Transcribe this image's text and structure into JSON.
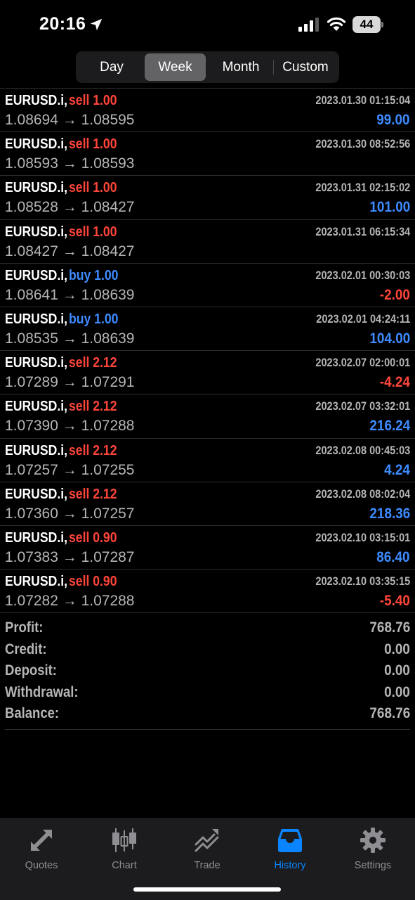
{
  "status_bar": {
    "time": "20:16",
    "battery": "44"
  },
  "periods": {
    "tabs": [
      {
        "label": "Day"
      },
      {
        "label": "Week"
      },
      {
        "label": "Month"
      },
      {
        "label": "Custom"
      }
    ],
    "selected": "Week"
  },
  "deals": [
    {
      "symbol": "EURUSD.i,",
      "side": "sell 1.00",
      "prices": "1.08694 → 1.08595",
      "time": "2023.01.30 01:15:04",
      "profit": "99.00"
    },
    {
      "symbol": "EURUSD.i,",
      "side": "sell 1.00",
      "prices": "1.08593 → 1.08593",
      "time": "2023.01.30 08:52:56",
      "profit": ""
    },
    {
      "symbol": "EURUSD.i,",
      "side": "sell 1.00",
      "prices": "1.08528 → 1.08427",
      "time": "2023.01.31 02:15:02",
      "profit": "101.00"
    },
    {
      "symbol": "EURUSD.i,",
      "side": "sell 1.00",
      "prices": "1.08427 → 1.08427",
      "time": "2023.01.31 06:15:34",
      "profit": ""
    },
    {
      "symbol": "EURUSD.i,",
      "side": "buy 1.00",
      "prices": "1.08641 → 1.08639",
      "time": "2023.02.01 00:30:03",
      "profit": "-2.00"
    },
    {
      "symbol": "EURUSD.i,",
      "side": "buy 1.00",
      "prices": "1.08535 → 1.08639",
      "time": "2023.02.01 04:24:11",
      "profit": "104.00"
    },
    {
      "symbol": "EURUSD.i,",
      "side": "sell 2.12",
      "prices": "1.07289 → 1.07291",
      "time": "2023.02.07 02:00:01",
      "profit": "-4.24"
    },
    {
      "symbol": "EURUSD.i,",
      "side": "sell 2.12",
      "prices": "1.07390 → 1.07288",
      "time": "2023.02.07 03:32:01",
      "profit": "216.24"
    },
    {
      "symbol": "EURUSD.i,",
      "side": "sell 2.12",
      "prices": "1.07257 → 1.07255",
      "time": "2023.02.08 00:45:03",
      "profit": "4.24"
    },
    {
      "symbol": "EURUSD.i,",
      "side": "sell 2.12",
      "prices": "1.07360 → 1.07257",
      "time": "2023.02.08 08:02:04",
      "profit": "218.36"
    },
    {
      "symbol": "EURUSD.i,",
      "side": "sell 0.90",
      "prices": "1.07383 → 1.07287",
      "time": "2023.02.10 03:15:01",
      "profit": "86.40"
    },
    {
      "symbol": "EURUSD.i,",
      "side": "sell 0.90",
      "prices": "1.07282 → 1.07288",
      "time": "2023.02.10 03:35:15",
      "profit": "-5.40"
    }
  ],
  "summary": [
    {
      "label": "Profit:",
      "value": "768.76"
    },
    {
      "label": "Credit:",
      "value": "0.00"
    },
    {
      "label": "Deposit:",
      "value": "0.00"
    },
    {
      "label": "Withdrawal:",
      "value": "0.00"
    },
    {
      "label": "Balance:",
      "value": "768.76"
    }
  ],
  "tab_bar": {
    "tabs": [
      {
        "label": "Quotes",
        "icon": "quotes-arrows-icon"
      },
      {
        "label": "Chart",
        "icon": "candlestick-chart-icon"
      },
      {
        "label": "Trade",
        "icon": "trade-trend-icon"
      },
      {
        "label": "History",
        "icon": "history-inbox-icon"
      },
      {
        "label": "Settings",
        "icon": "settings-gear-icon"
      }
    ],
    "active": "History"
  },
  "colors": {
    "sell": "#ff453a",
    "buy": "#3d8bff",
    "profit_positive": "#3d8bff",
    "profit_negative": "#ff453a",
    "active_tab": "#0a84ff",
    "inactive_tab": "#8e8e93"
  }
}
